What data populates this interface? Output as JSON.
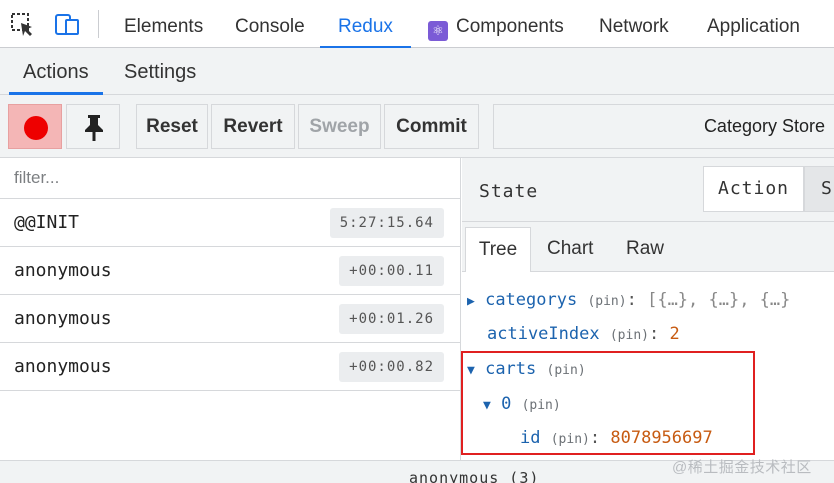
{
  "topbar": {
    "tabs": [
      {
        "label": "Elements"
      },
      {
        "label": "Console"
      },
      {
        "label": "Redux"
      },
      {
        "label": "Components"
      },
      {
        "label": "Network"
      },
      {
        "label": "Application"
      }
    ],
    "active_tab": "Redux",
    "component_icon_glyph": "⚛"
  },
  "subtabs": {
    "items": [
      {
        "label": "Actions"
      },
      {
        "label": "Settings"
      }
    ],
    "active": "Actions"
  },
  "toolbar": {
    "reset_label": "Reset",
    "revert_label": "Revert",
    "sweep_label": "Sweep",
    "commit_label": "Commit",
    "store_label": "Category Store"
  },
  "actions": {
    "filter_placeholder": "filter...",
    "rows": [
      {
        "name": "@@INIT",
        "time": "5:27:15.64"
      },
      {
        "name": "anonymous",
        "time": "+00:00.11"
      },
      {
        "name": "anonymous",
        "time": "+00:01.26"
      },
      {
        "name": "anonymous",
        "time": "+00:00.82"
      }
    ]
  },
  "inspector": {
    "title": "State",
    "action_btn": "Action",
    "state_btn": "St",
    "tabs": [
      {
        "label": "Tree"
      },
      {
        "label": "Chart"
      },
      {
        "label": "Raw"
      }
    ],
    "active_tab": "Tree",
    "tree": {
      "categorys": {
        "key": "categorys",
        "pin": "(pin)",
        "value": "[{…}, {…}, {…}"
      },
      "activeIndex": {
        "key": "activeIndex",
        "pin": "(pin)",
        "value": "2"
      },
      "carts": {
        "key": "carts",
        "pin": "(pin)"
      },
      "item0": {
        "key": "0",
        "pin": "(pin)"
      },
      "id": {
        "key": "id",
        "pin": "(pin)",
        "value": "8078956697"
      }
    }
  },
  "status": {
    "text": "anonymous (3)"
  },
  "watermark": "@稀土掘金技术社区",
  "colors": {
    "accent": "#1a73e8",
    "record": "#ee0000",
    "key": "#1c63ae",
    "number": "#c75b12",
    "highlight": "#e02020"
  }
}
